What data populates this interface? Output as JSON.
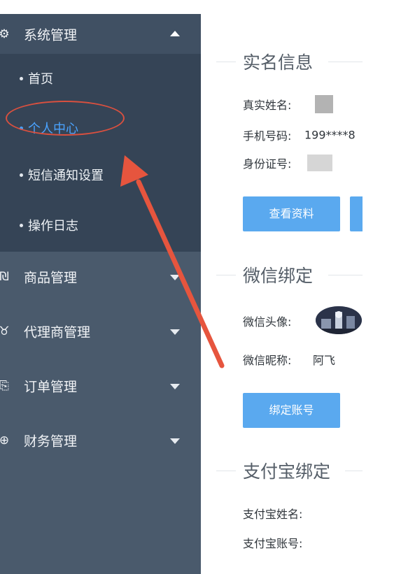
{
  "sidebar": {
    "system": {
      "label": "系统管理",
      "icon": "gear-icon"
    },
    "submenu": [
      {
        "label": "首页",
        "active": false
      },
      {
        "label": "个人中心",
        "active": true
      },
      {
        "label": "短信通知设置",
        "active": false
      },
      {
        "label": "操作日志",
        "active": false
      }
    ],
    "menus": [
      {
        "label": "商品管理",
        "icon": "product-icon"
      },
      {
        "label": "代理商管理",
        "icon": "agent-icon"
      },
      {
        "label": "订单管理",
        "icon": "order-icon"
      },
      {
        "label": "财务管理",
        "icon": "finance-icon"
      }
    ]
  },
  "main": {
    "realname": {
      "title": "实名信息",
      "name_label": "真实姓名:",
      "phone_label": "手机号码:",
      "phone_value": "199****8",
      "id_label": "身份证号:",
      "view_button": "查看资料"
    },
    "wechat": {
      "title": "微信绑定",
      "avatar_label": "微信头像:",
      "nickname_label": "微信昵称:",
      "nickname_value": "阿飞",
      "bind_button": "绑定账号"
    },
    "alipay": {
      "title": "支付宝绑定",
      "name_label": "支付宝姓名:",
      "account_label": "支付宝账号:"
    }
  },
  "colors": {
    "sidebar_bg": "#4a5a6c",
    "submenu_bg": "#354456",
    "active": "#4aa3ff",
    "button": "#5aa9ef",
    "annotation": "#e6553e"
  }
}
